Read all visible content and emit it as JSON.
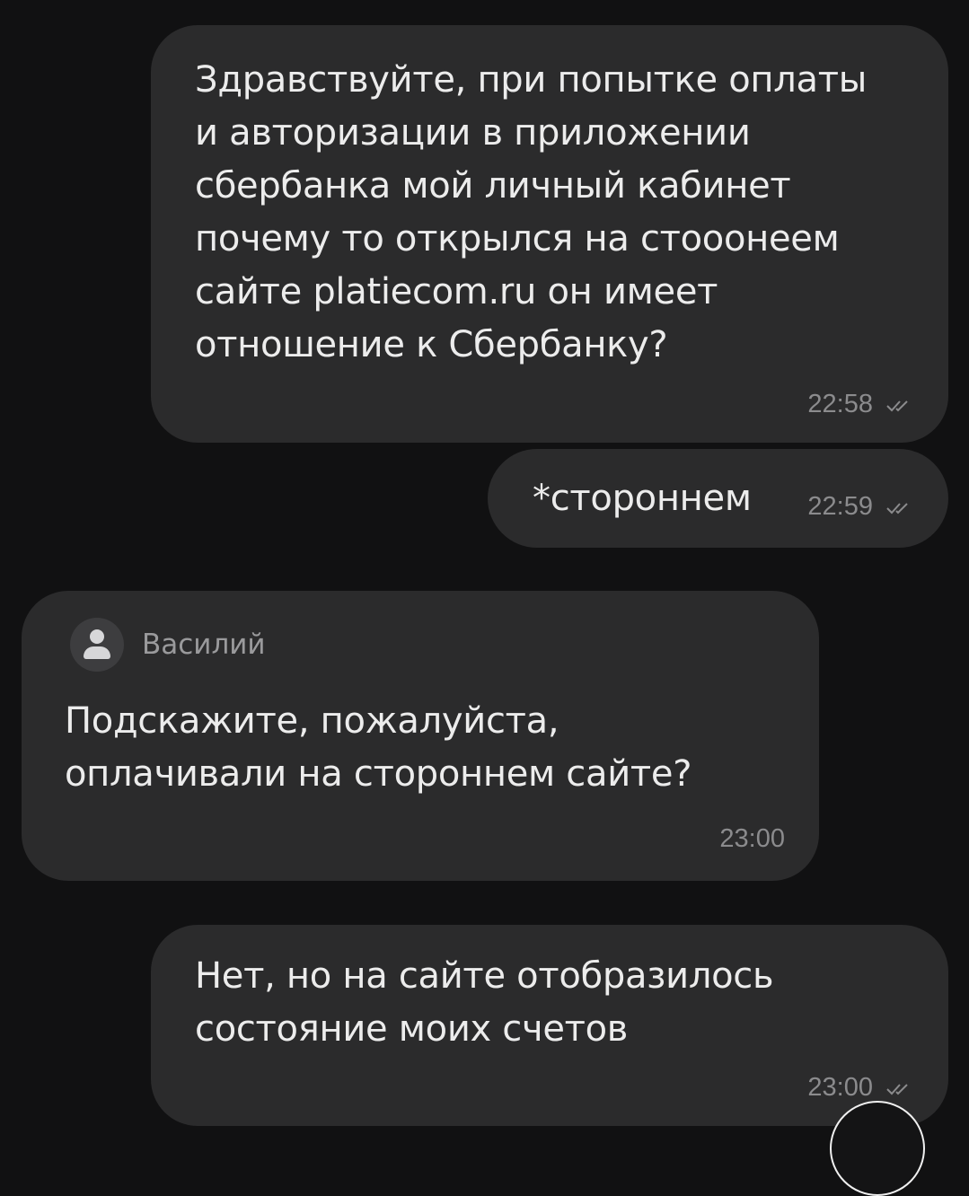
{
  "messages": [
    {
      "direction": "outgoing",
      "text": "Здравствуйте, при попытке оплаты\nи авторизации в приложении\nсбербанка мой личный кабинет\nпочему то открылся на стооонеем\nсайте platiecom.ru он имеет\nотношение к Сбербанку?",
      "time": "22:58",
      "status_icon": "double-check-icon"
    },
    {
      "direction": "outgoing",
      "text": "*стороннем",
      "time": "22:59",
      "status_icon": "double-check-icon"
    },
    {
      "direction": "incoming",
      "sender": "Василий",
      "avatar_icon": "person-icon",
      "text": "Подскажите, пожалуйста,\nоплачивали на стороннем сайте?",
      "time": "23:00"
    },
    {
      "direction": "outgoing",
      "text": "Нет, но на сайте отобразилось\nсостояние моих счетов",
      "time": "23:00",
      "status_icon": "double-check-icon"
    }
  ],
  "colors": {
    "background": "#111112",
    "bubble": "#2b2b2c",
    "text": "#ececec",
    "meta": "#8b8b8d"
  }
}
